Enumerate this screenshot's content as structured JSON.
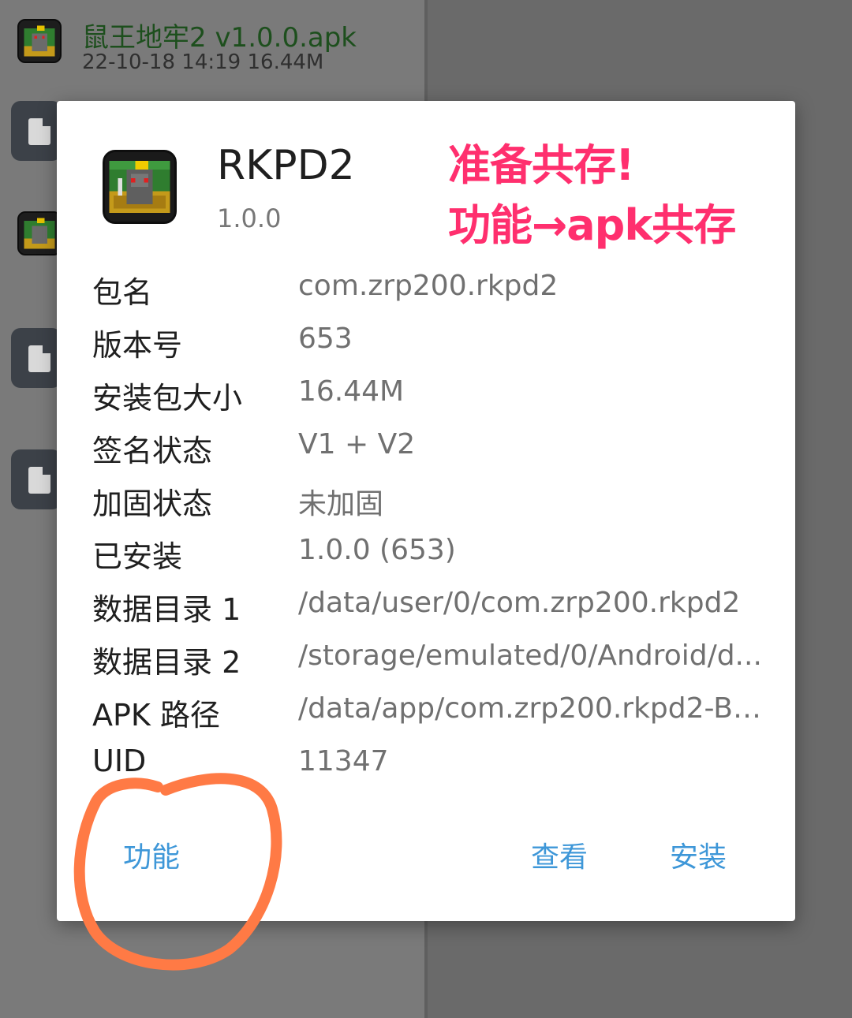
{
  "background": {
    "top_file": {
      "name": "鼠王地牢2 v1.0.0.apk",
      "date": "22-10-18 14:19",
      "size": "16.44M"
    },
    "icons": [
      "apk-icon",
      "file-icon",
      "apk-icon",
      "file-icon",
      "file-icon"
    ]
  },
  "dialog": {
    "app_name": "RKPD2",
    "version": "1.0.0",
    "note": {
      "line1": "准备共存!",
      "line2": "功能→apk共存",
      "color": "#ff2f6e"
    },
    "rows": [
      {
        "label": "包名",
        "value": "com.zrp200.rkpd2"
      },
      {
        "label": "版本号",
        "value": "653"
      },
      {
        "label": "安装包大小",
        "value": "16.44M"
      },
      {
        "label": "签名状态",
        "value": "V1 + V2"
      },
      {
        "label": "加固状态",
        "value": "未加固"
      },
      {
        "label": "已安装",
        "value": "1.0.0 (653)"
      },
      {
        "label": "数据目录 1",
        "value": "/data/user/0/com.zrp200.rkpd2"
      },
      {
        "label": "数据目录 2",
        "value": "/storage/emulated/0/Android/d..."
      },
      {
        "label": "APK 路径",
        "value": "/data/app/com.zrp200.rkpd2-BJ..."
      },
      {
        "label": "UID",
        "value": "11347"
      }
    ],
    "buttons": {
      "function": "功能",
      "view": "查看",
      "install": "安装"
    },
    "accent_color": "#3e97d8",
    "annotation_color": "#ff7a45"
  }
}
